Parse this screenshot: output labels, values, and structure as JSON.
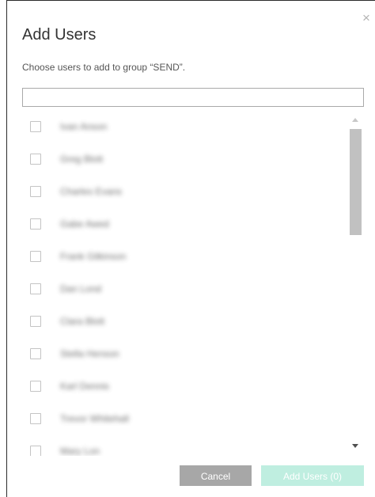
{
  "dialog": {
    "title": "Add Users",
    "subtitle": "Choose users to add to group “SEND”.",
    "close_label": "×"
  },
  "search": {
    "value": "",
    "placeholder": ""
  },
  "users": [
    {
      "name": "Ivan Anson",
      "checked": false
    },
    {
      "name": "Greg Blott",
      "checked": false
    },
    {
      "name": "Charles Evans",
      "checked": false
    },
    {
      "name": "Gabe Awed",
      "checked": false
    },
    {
      "name": "Frank Gilkinson",
      "checked": false
    },
    {
      "name": "Dan Lond",
      "checked": false
    },
    {
      "name": "Clara Blott",
      "checked": false
    },
    {
      "name": "Stella Henson",
      "checked": false
    },
    {
      "name": "Karl Dennis",
      "checked": false
    },
    {
      "name": "Trevor Whitehall",
      "checked": false
    },
    {
      "name": "Mary Lon",
      "checked": false
    }
  ],
  "footer": {
    "cancel_label": "Cancel",
    "add_label": "Add Users (0)"
  },
  "colors": {
    "cancel_bg": "#a7a7a7",
    "add_bg_disabled": "#bfeee0",
    "border": "#a9a9a9"
  }
}
